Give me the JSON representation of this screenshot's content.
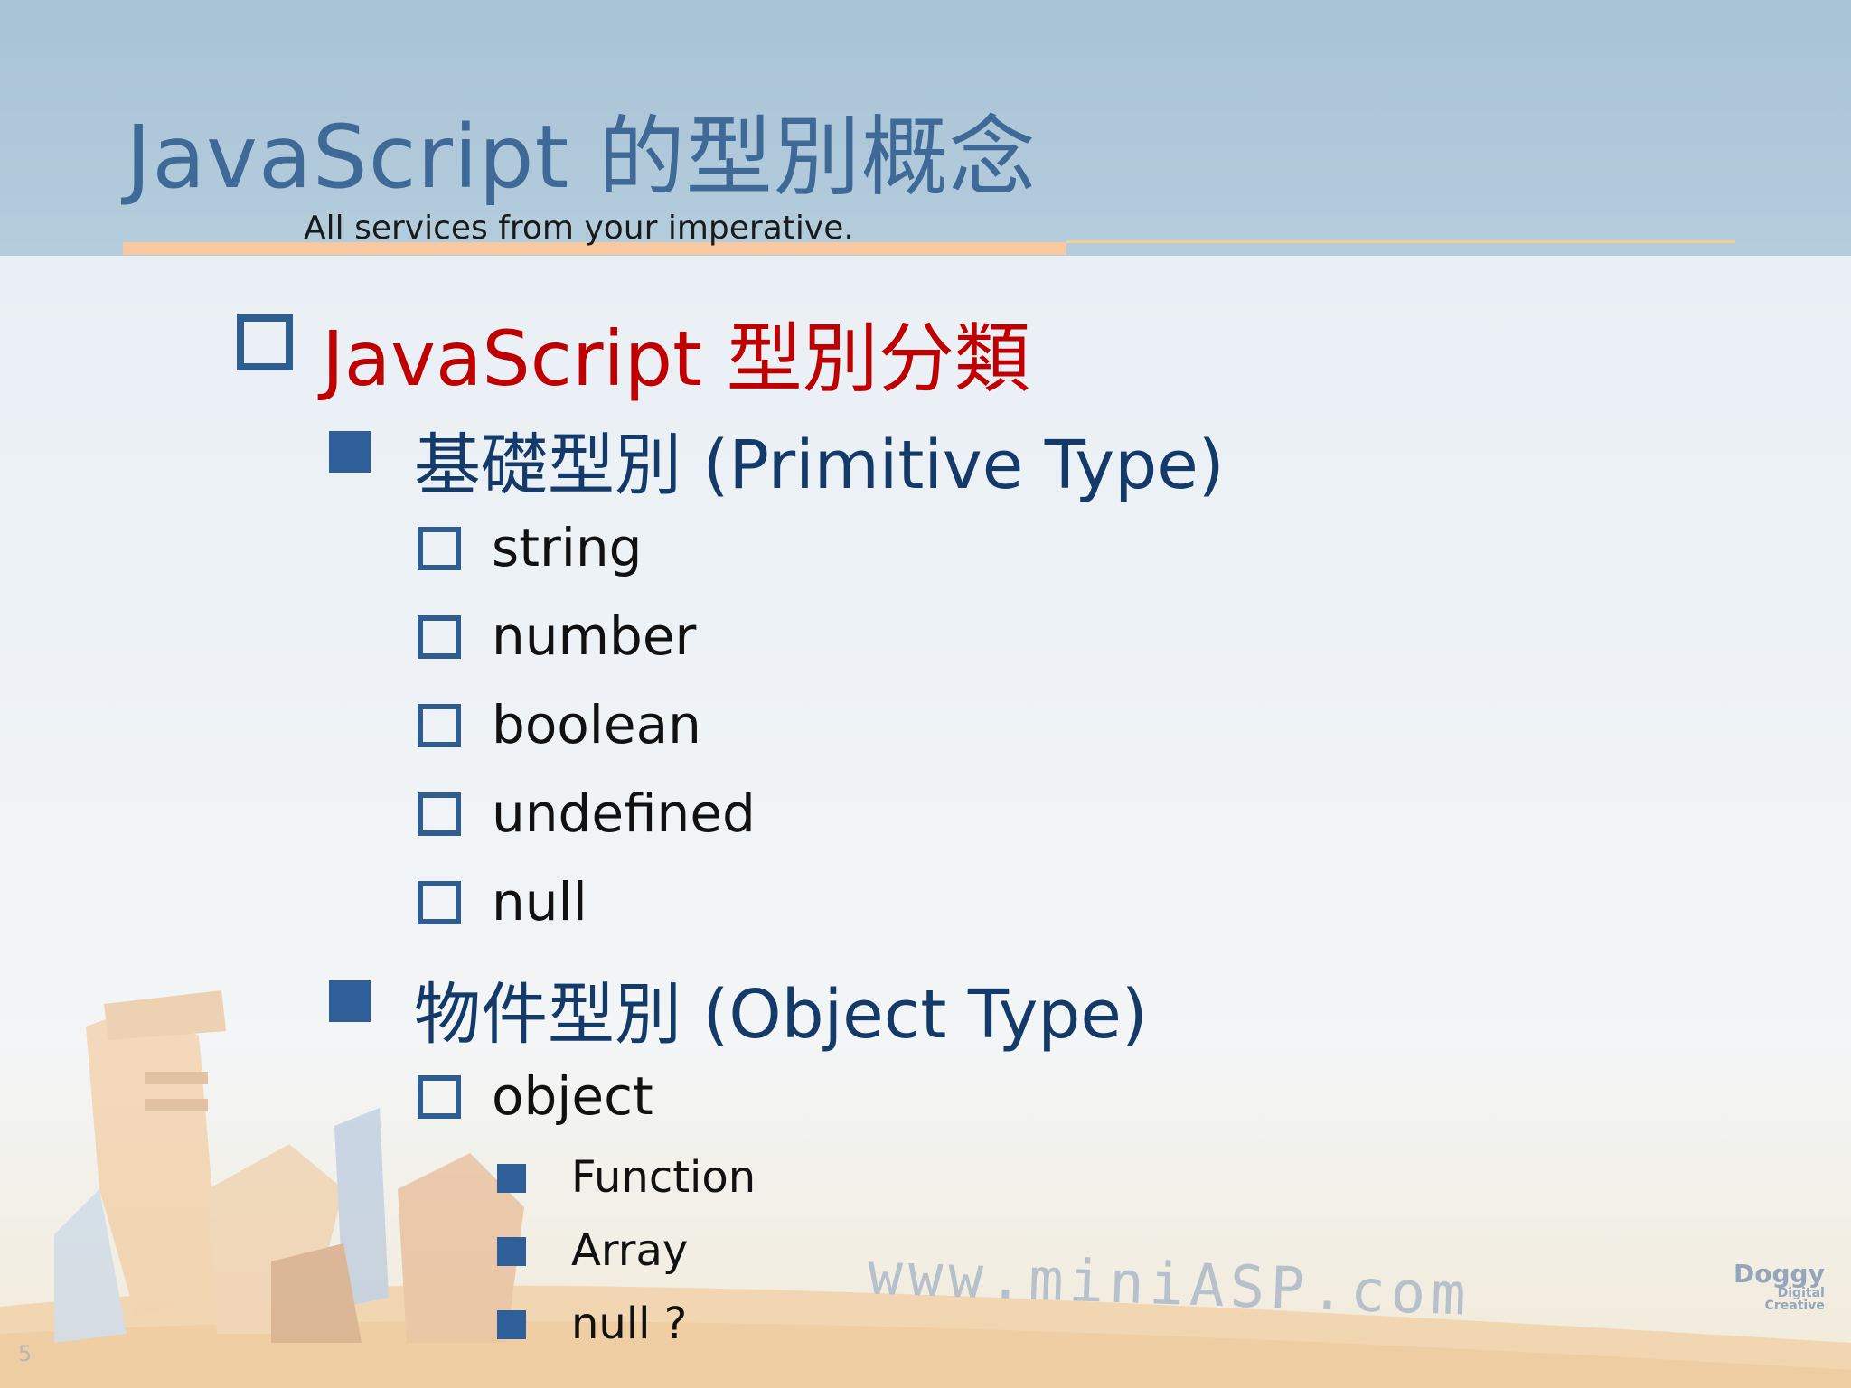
{
  "slide": {
    "title": "JavaScript 的型別概念",
    "subtitle": "All services from your imperative.",
    "page_number": "5"
  },
  "outline": {
    "heading": "JavaScript 型別分類",
    "primitive": {
      "label": "基礎型別 (Primitive Type)",
      "items": [
        "string",
        "number",
        "boolean",
        "undefined",
        "null"
      ]
    },
    "object_types": {
      "label": "物件型別 (Object Type)",
      "object": {
        "label": "object",
        "items": [
          "Function",
          "Array",
          "null ?"
        ]
      }
    }
  },
  "watermark": {
    "text": "www.miniASP.com"
  },
  "logo": {
    "name": "Doggy",
    "line2": "Digital",
    "line3": "Creative"
  },
  "colors": {
    "title": "#3f6a98",
    "heading": "#c00000",
    "level2": "#143a6a",
    "bullet": "#2e5f98",
    "header_band": "#b4cddd",
    "accent_rule": "#f8c9a0"
  }
}
